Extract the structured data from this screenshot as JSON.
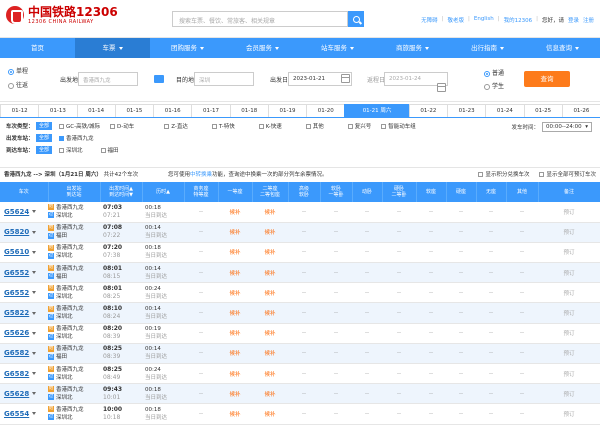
{
  "header": {
    "logo_cn": "中国铁路12306",
    "logo_en": "12306 CHINA RAILWAY",
    "search_placeholder": "搜索车票、餐饮、常旅客、相关规章",
    "links": [
      "无障碍",
      "敬老版",
      "English",
      "我的12306"
    ],
    "greeting": "您好，请",
    "login": "登录",
    "register": "注册"
  },
  "nav": [
    "首页",
    "车票",
    "团购服务",
    "会员服务",
    "站车服务",
    "商旅服务",
    "出行指南",
    "信息查询"
  ],
  "query": {
    "oneway": "单程",
    "roundtrip": "往返",
    "from_label": "出发地",
    "from_value": "香港西九龙",
    "to_label": "目的地",
    "to_value": "深圳",
    "depart_label": "出发日",
    "depart_value": "2023-01-21",
    "return_label": "返程日",
    "return_value": "2023-01-24",
    "normal": "普通",
    "student": "学生",
    "query_button": "查询"
  },
  "dates": [
    "01-12",
    "01-13",
    "01-14",
    "01-15",
    "01-16",
    "01-17",
    "01-18",
    "01-19",
    "01-20",
    "01-21 周六",
    "01-22",
    "01-23",
    "01-24",
    "01-25",
    "01-26"
  ],
  "filters": {
    "type_label": "车次类型：",
    "all": "全部",
    "types": [
      "GC-高铁/城际",
      "D-动车",
      "Z-直达",
      "T-特快",
      "K-快速",
      "其他",
      "复兴号",
      "智能动车组"
    ],
    "from_label": "出发车站：",
    "from_stations": [
      "香港西九龙"
    ],
    "to_label": "到达车站：",
    "to_stations": [
      "深圳北",
      "福田"
    ],
    "time_label": "发车时间：",
    "time_value": "00:00--24:00"
  },
  "summary": {
    "route": "香港西九龙 --> 深圳（1月21日 周六）",
    "count_text": "共计42个车次",
    "tip_pre": "您可使用",
    "tip_link": "中转换乘",
    "tip_post": "功能，查询途中换乘一次的部分列车余票情况。",
    "opt1": "显示积分兑换车次",
    "opt2": "显示全部可预订车次"
  },
  "columns": [
    "车次",
    "出发站\n到达站",
    "出发时间▲\n到达时间▼",
    "历时▲",
    "商务座\n特等座",
    "一等座",
    "二等座\n二等包座",
    "高级\n软卧",
    "软卧\n一等卧",
    "动卧",
    "硬卧\n二等卧",
    "软座",
    "硬座",
    "无座",
    "其他",
    "备注"
  ],
  "rows": [
    {
      "no": "G5624",
      "from": "香港西九龙",
      "to": "深圳北",
      "dep": "07:03",
      "arr": "07:21",
      "dur": "00:18",
      "day": "当日到达",
      "biz": "--",
      "first": "候补",
      "second": "候补",
      "book": "预订"
    },
    {
      "no": "G5820",
      "from": "香港西九龙",
      "to": "福田",
      "dep": "07:08",
      "arr": "07:22",
      "dur": "00:14",
      "day": "当日到达",
      "biz": "--",
      "first": "候补",
      "second": "候补",
      "book": "预订"
    },
    {
      "no": "G5610",
      "from": "香港西九龙",
      "to": "深圳北",
      "dep": "07:20",
      "arr": "07:38",
      "dur": "00:18",
      "day": "当日到达",
      "biz": "--",
      "first": "候补",
      "second": "候补",
      "book": "预订"
    },
    {
      "no": "G6552",
      "from": "香港西九龙",
      "to": "福田",
      "dep": "08:01",
      "arr": "08:15",
      "dur": "00:14",
      "day": "当日到达",
      "biz": "--",
      "first": "候补",
      "second": "候补",
      "book": "预订"
    },
    {
      "no": "G6552",
      "from": "香港西九龙",
      "to": "深圳北",
      "dep": "08:01",
      "arr": "08:25",
      "dur": "00:24",
      "day": "当日到达",
      "biz": "--",
      "first": "候补",
      "second": "候补",
      "book": "预订"
    },
    {
      "no": "G5822",
      "from": "香港西九龙",
      "to": "深圳北",
      "dep": "08:10",
      "arr": "08:24",
      "dur": "00:14",
      "day": "当日到达",
      "biz": "--",
      "first": "候补",
      "second": "候补",
      "book": "预订"
    },
    {
      "no": "G5626",
      "from": "香港西九龙",
      "to": "深圳北",
      "dep": "08:20",
      "arr": "08:39",
      "dur": "00:19",
      "day": "当日到达",
      "biz": "--",
      "first": "候补",
      "second": "候补",
      "book": "预订"
    },
    {
      "no": "G6582",
      "from": "香港西九龙",
      "to": "福田",
      "dep": "08:25",
      "arr": "08:39",
      "dur": "00:14",
      "day": "当日到达",
      "biz": "--",
      "first": "候补",
      "second": "候补",
      "book": "预订"
    },
    {
      "no": "G6582",
      "from": "香港西九龙",
      "to": "深圳北",
      "dep": "08:25",
      "arr": "08:49",
      "dur": "00:24",
      "day": "当日到达",
      "biz": "--",
      "first": "候补",
      "second": "候补",
      "book": "预订"
    },
    {
      "no": "G5628",
      "from": "香港西九龙",
      "to": "深圳北",
      "dep": "09:43",
      "arr": "10:01",
      "dur": "00:18",
      "day": "当日到达",
      "biz": "--",
      "first": "候补",
      "second": "候补",
      "book": "预订"
    },
    {
      "no": "G6554",
      "from": "香港西九龙",
      "to": "深圳北",
      "dep": "10:00",
      "arr": "10:18",
      "dur": "00:18",
      "day": "当日到达",
      "biz": "--",
      "first": "候补",
      "second": "候补",
      "book": "预订"
    }
  ],
  "empty": "--",
  "station_start": "始",
  "station_end": "过"
}
